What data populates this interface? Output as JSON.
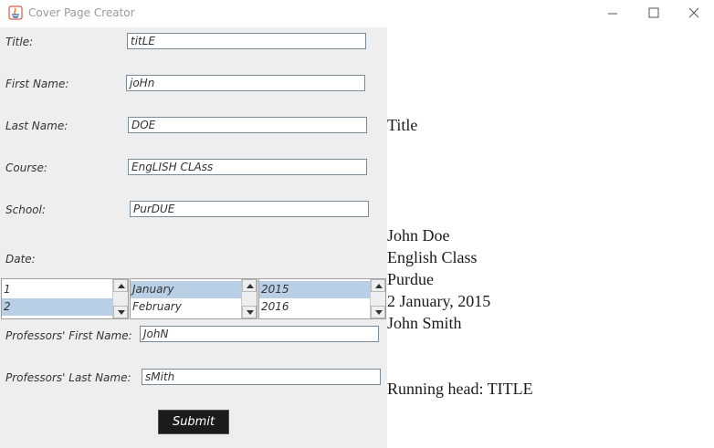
{
  "window": {
    "title": "Cover Page Creator",
    "icon": "java-icon"
  },
  "form": {
    "title_label": "Title:",
    "title_value": "titLE",
    "first_label": "First Name:",
    "first_value": "joHn",
    "last_label": "Last Name:",
    "last_value": "DOE",
    "course_label": "Course:",
    "course_value": "EngLISH CLAss",
    "school_label": "School:",
    "school_value": "PurDUE",
    "date_label": "Date:",
    "day_items": [
      "1",
      "2"
    ],
    "day_selected": "2",
    "month_items": [
      "January",
      "February"
    ],
    "month_selected": "January",
    "year_items": [
      "2015",
      "2016"
    ],
    "year_selected": "2015",
    "prof_first_label": "Professors' First Name:",
    "prof_first_value": "JohN",
    "prof_last_label": "Professors' Last Name:",
    "prof_last_value": "sMith",
    "submit_label": "Submit"
  },
  "output": {
    "title": "Title",
    "name": "John Doe",
    "course": "English Class",
    "school": "Purdue",
    "date": "2 January, 2015",
    "professor": "John Smith",
    "running_head": "Running head: TITLE"
  },
  "colors": {
    "panel": "#eeeeee",
    "selection": "#b8cfe5",
    "button": "#1b1b1b"
  }
}
